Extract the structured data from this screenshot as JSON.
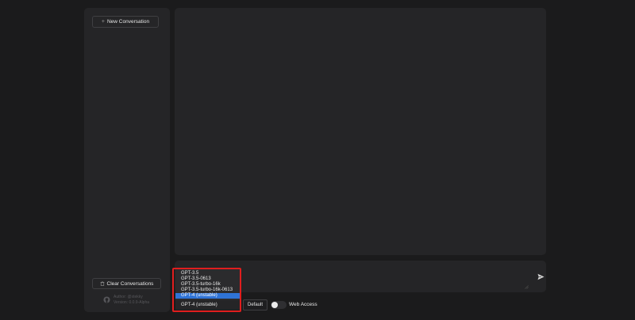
{
  "sidebar": {
    "new_conversation_label": "New Conversation",
    "clear_conversations_label": "Clear Conversations",
    "author_line": "Author: @xtekky",
    "version_line": "Version: 0.0.9-Alpha"
  },
  "input": {
    "model_options": [
      "GPT-3.5",
      "GPT-3.5-0613",
      "GPT-3.5-turbo-16k",
      "GPT-3.5-turbo-16k-0613",
      "GPT-4 (unstable)"
    ],
    "selected_option_index": 4,
    "selected_model": "GPT-4 (unstable)",
    "mode_label": "Default",
    "web_access_label": "Web Access",
    "web_access_enabled": false
  },
  "colors": {
    "background": "#1b1b1c",
    "panel": "#252527",
    "selection": "#2f73d6",
    "highlight": "#e01e1e"
  },
  "icons": {
    "new": "plus-icon",
    "clear": "trash-icon",
    "author": "github-icon",
    "send": "send-icon"
  }
}
